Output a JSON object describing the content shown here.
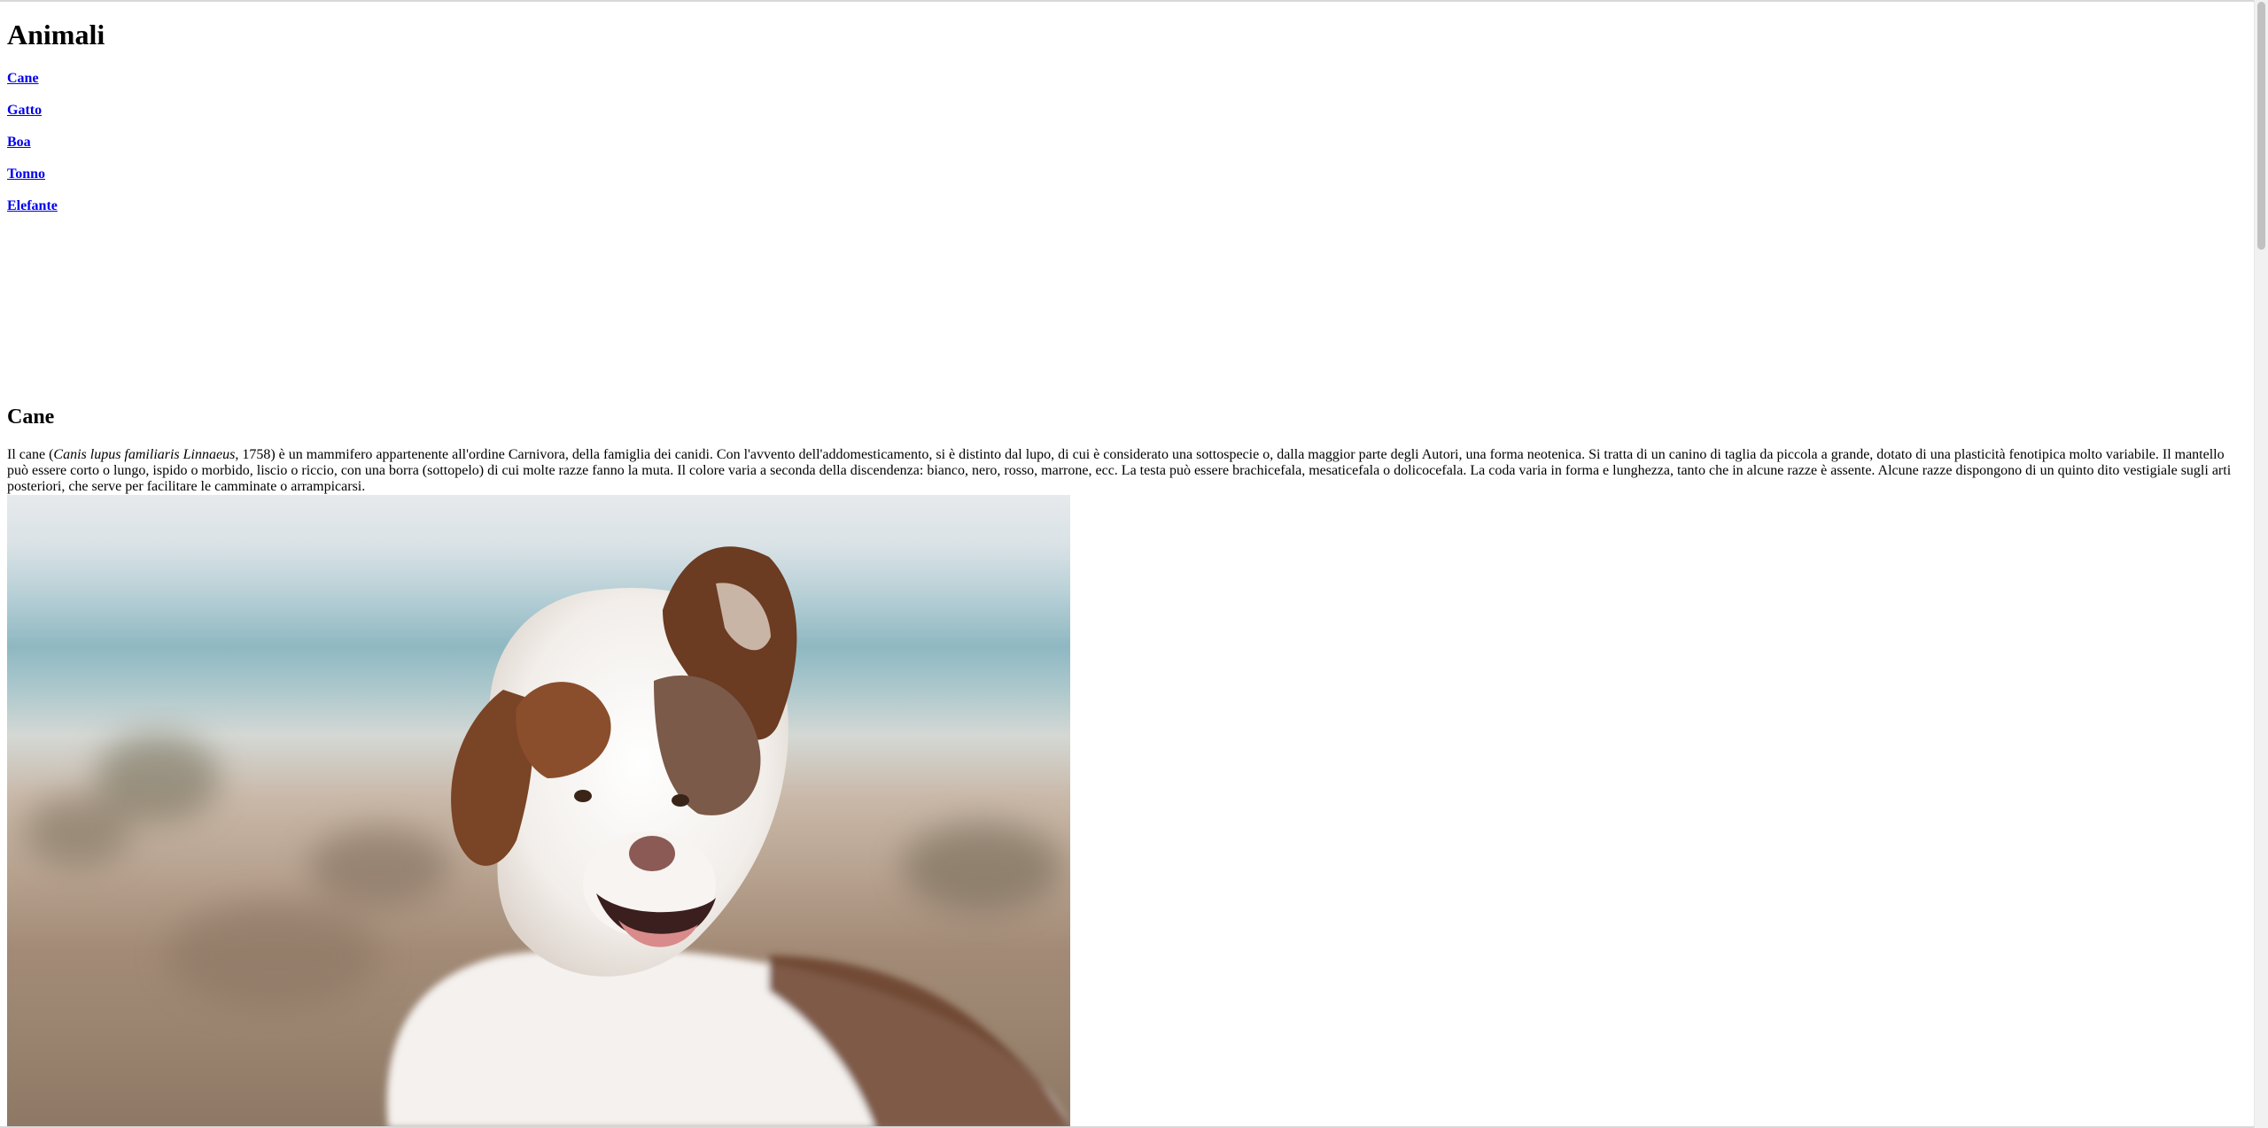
{
  "page_title": "Animali",
  "nav": {
    "items": [
      {
        "label": "Cane"
      },
      {
        "label": "Gatto"
      },
      {
        "label": "Boa"
      },
      {
        "label": "Tonno"
      },
      {
        "label": "Elefante"
      }
    ]
  },
  "section": {
    "heading": "Cane",
    "desc_prefix": "Il cane (",
    "desc_italic": "Canis lupus familiaris Linnaeus",
    "desc_rest": ", 1758) è un mammifero appartenente all'ordine Carnivora, della famiglia dei canidi. Con l'avvento dell'addomesticamento, si è distinto dal lupo, di cui è considerato una sottospecie o, dalla maggior parte degli Autori, una forma neotenica. Si tratta di un canino di taglia da piccola a grande, dotato di una plasticità fenotipica molto variabile. Il mantello può essere corto o lungo, ispido o morbido, liscio o riccio, con una borra (sottopelo) di cui molte razze fanno la muta. Il colore varia a seconda della discendenza: bianco, nero, rosso, marrone, ecc. La testa può essere brachicefala, mesaticefala o dolicocefala. La coda varia in forma e lunghezza, tanto che in alcune razze è assente. Alcune razze dispongono di un quinto dito vestigiale sugli arti posteriori, che serve per facilitare le camminate o arrampicarsi."
  },
  "colors": {
    "link": "#0000ee",
    "text": "#000000",
    "background": "#ffffff"
  }
}
